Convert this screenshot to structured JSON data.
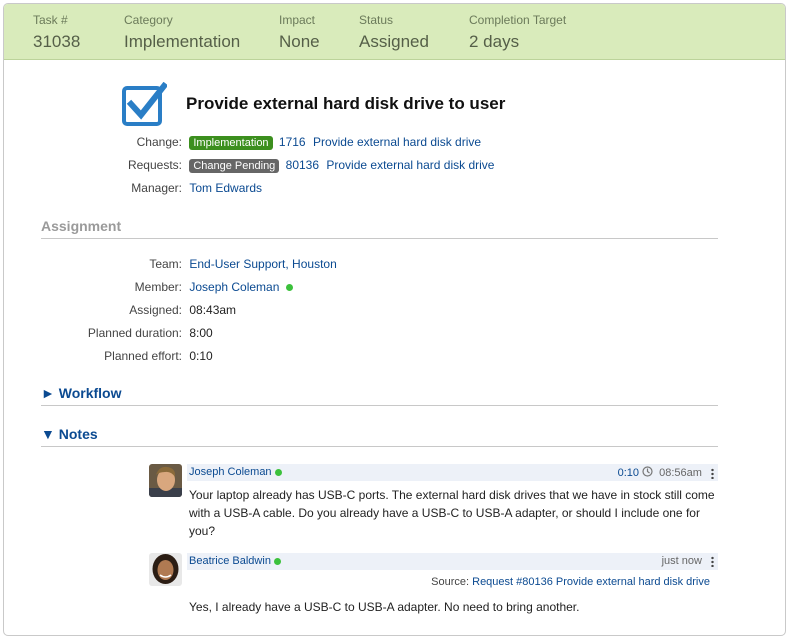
{
  "header": {
    "task_label": "Task #",
    "task_value": "31038",
    "category_label": "Category",
    "category_value": "Implementation",
    "impact_label": "Impact",
    "impact_value": "None",
    "status_label": "Status",
    "status_value": "Assigned",
    "target_label": "Completion Target",
    "target_value": "2 days"
  },
  "task": {
    "title": "Provide external hard disk drive to user",
    "icon": "checkbox-checked-icon"
  },
  "change": {
    "label": "Change:",
    "badge": "Implementation",
    "number": "1716",
    "text": "Provide external hard disk drive"
  },
  "requests": {
    "label": "Requests:",
    "badge": "Change Pending",
    "number": "80136",
    "text": "Provide external hard disk drive"
  },
  "manager": {
    "label": "Manager:",
    "value": "Tom Edwards"
  },
  "assignment": {
    "heading": "Assignment",
    "team_label": "Team:",
    "team_value": "End-User Support, Houston",
    "member_label": "Member:",
    "member_value": "Joseph Coleman",
    "assigned_label": "Assigned:",
    "assigned_value": "08:43am",
    "duration_label": "Planned duration:",
    "duration_value": "8:00",
    "effort_label": "Planned effort:",
    "effort_value": "0:10"
  },
  "workflow": {
    "heading": "► Workflow"
  },
  "notes": {
    "heading": "▼ Notes",
    "items": [
      {
        "author": "Joseph Coleman",
        "effort": "0:10",
        "time": "08:56am",
        "body": "Your laptop already has USB-C ports. The external hard disk drives that we have in stock still come with a USB-A cable. Do you already have a USB-C to USB-A adapter, or should I include one for you?"
      },
      {
        "author": "Beatrice Baldwin",
        "time": "just now",
        "source_label": "Source:",
        "source_link": "Request #80136 Provide external hard disk drive",
        "body": "Yes, I already have a USB-C to USB-A adapter. No need to bring another."
      }
    ]
  },
  "colors": {
    "header_bg": "#d9ebbb",
    "link": "#0b4a91",
    "online": "#3cc13c",
    "badge_green": "#3c8f1e"
  }
}
